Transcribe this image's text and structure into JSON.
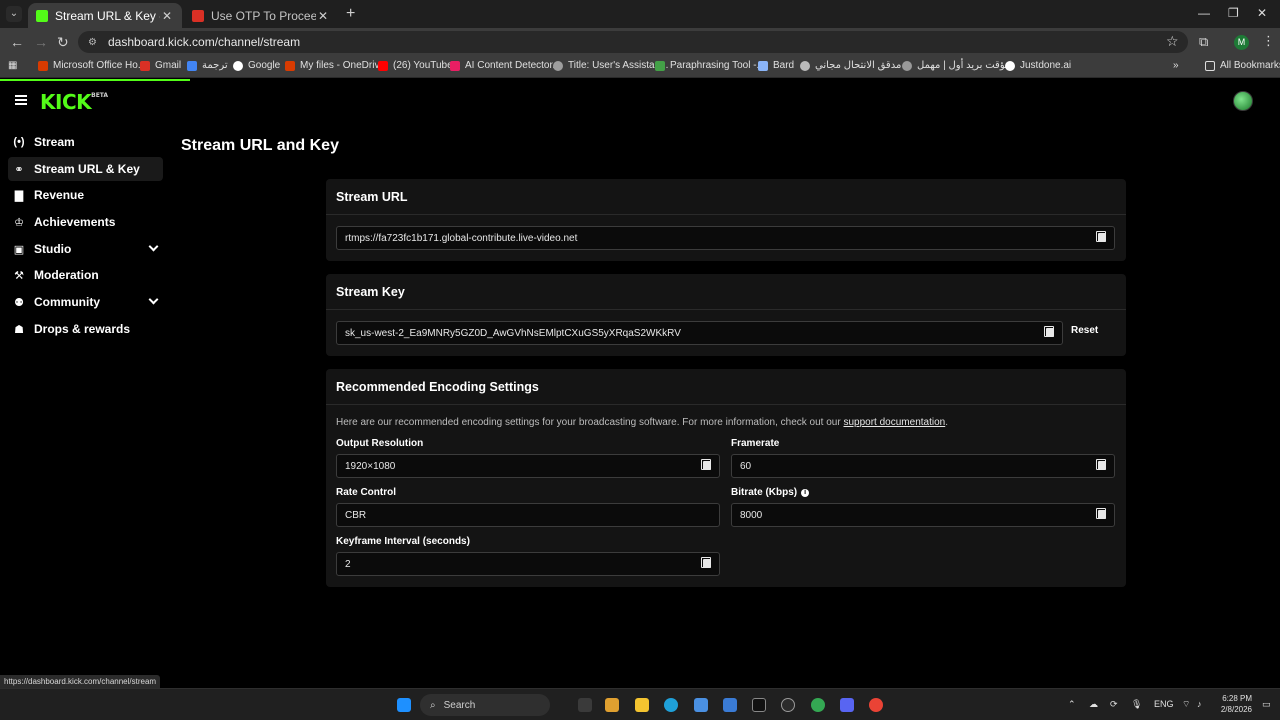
{
  "browser": {
    "tabs": [
      {
        "title": "Stream URL & Key - Kick Dashb",
        "active": true
      },
      {
        "title": "Use OTP To Proceed - mambu…",
        "active": false
      }
    ],
    "url": "dashboard.kick.com/channel/stream",
    "profile_initial": "M",
    "bookmarks": [
      {
        "label": "Microsoft Office Ho...",
        "color": "#d83b01"
      },
      {
        "label": "Gmail",
        "color": "#d93025"
      },
      {
        "label": "ترجمة",
        "color": "#4285f4"
      },
      {
        "label": "Google",
        "color": "#ffffff"
      },
      {
        "label": "My files - OneDrive",
        "color": "#d83b01"
      },
      {
        "label": "(26) YouTube",
        "color": "#ff0000"
      },
      {
        "label": "AI Content Detector...",
        "color": "#e91e63"
      },
      {
        "label": "Title: User's Assistan...",
        "color": "#9e9e9e"
      },
      {
        "label": "Paraphrasing Tool -...",
        "color": "#43a047"
      },
      {
        "label": "Bard",
        "color": "#8ab4f8"
      },
      {
        "label": "مدقق الانتحال مجاني",
        "color": "#bbbbbb"
      },
      {
        "label": "مؤقت بريد أول | مهمل",
        "color": "#999999"
      },
      {
        "label": "Justdone.ai",
        "color": "#ffffff"
      }
    ],
    "all_bookmarks_label": "All Bookmarks",
    "status_url": "https://dashboard.kick.com/channel/stream"
  },
  "kick": {
    "logo": "KICK",
    "logo_badge": "BETA",
    "sidebar": [
      {
        "label": "Stream",
        "icon": "broadcast-icon",
        "glyph": "(•)",
        "expandable": false,
        "active": false
      },
      {
        "label": "Stream URL & Key",
        "icon": "link-icon",
        "glyph": "⚭",
        "expandable": false,
        "active": true
      },
      {
        "label": "Revenue",
        "icon": "chart-icon",
        "glyph": "▇",
        "expandable": false,
        "active": false
      },
      {
        "label": "Achievements",
        "icon": "trophy-icon",
        "glyph": "♔",
        "expandable": false,
        "active": false
      },
      {
        "label": "Studio",
        "icon": "studio-icon",
        "glyph": "▣",
        "expandable": true,
        "active": false
      },
      {
        "label": "Moderation",
        "icon": "wrench-icon",
        "glyph": "⚒",
        "expandable": false,
        "active": false
      },
      {
        "label": "Community",
        "icon": "people-icon",
        "glyph": "⚉",
        "expandable": true,
        "active": false
      },
      {
        "label": "Drops & rewards",
        "icon": "gift-icon",
        "glyph": "☗",
        "expandable": false,
        "active": false
      }
    ],
    "page_title": "Stream URL and Key",
    "stream_url": {
      "title": "Stream URL",
      "value": "rtmps://fa723fc1b171.global-contribute.live-video.net"
    },
    "stream_key": {
      "title": "Stream Key",
      "value": "sk_us-west-2_Ea9MNRy5GZ0D_AwGVhNsEMlptCXuGS5yXRqaS2WKkRV",
      "reset_label": "Reset"
    },
    "encoding": {
      "title": "Recommended Encoding Settings",
      "description": "Here are our recommended encoding settings for your broadcasting software. For more information, check out our ",
      "link_text": "support documentation",
      "description_end": ".",
      "output_resolution": {
        "label": "Output Resolution",
        "value": "1920×1080"
      },
      "framerate": {
        "label": "Framerate",
        "value": "60"
      },
      "rate_control": {
        "label": "Rate Control",
        "value": "CBR"
      },
      "bitrate": {
        "label": "Bitrate (Kbps)",
        "value": "8000"
      },
      "keyframe": {
        "label": "Keyframe Interval (seconds)",
        "value": "2"
      }
    }
  },
  "taskbar": {
    "search_label": "Search",
    "language": "ENG",
    "time": "6:28 PM",
    "date": "2/8/2026",
    "pinned": [
      {
        "name": "file-explorer-icon",
        "color": "#f4c430"
      },
      {
        "name": "edge-icon",
        "color": "#1fa0d8"
      },
      {
        "name": "store-icon",
        "color": "#4a90e2"
      },
      {
        "name": "vpn-icon",
        "color": "#3a7bd5"
      },
      {
        "name": "capcut-icon",
        "color": "#111111"
      },
      {
        "name": "obs-icon",
        "color": "#2b2b2b"
      },
      {
        "name": "chrome-icon",
        "color": "#34a853"
      },
      {
        "name": "discord-icon",
        "color": "#5865f2"
      },
      {
        "name": "chrome-alt-icon",
        "color": "#ea4335"
      }
    ]
  }
}
